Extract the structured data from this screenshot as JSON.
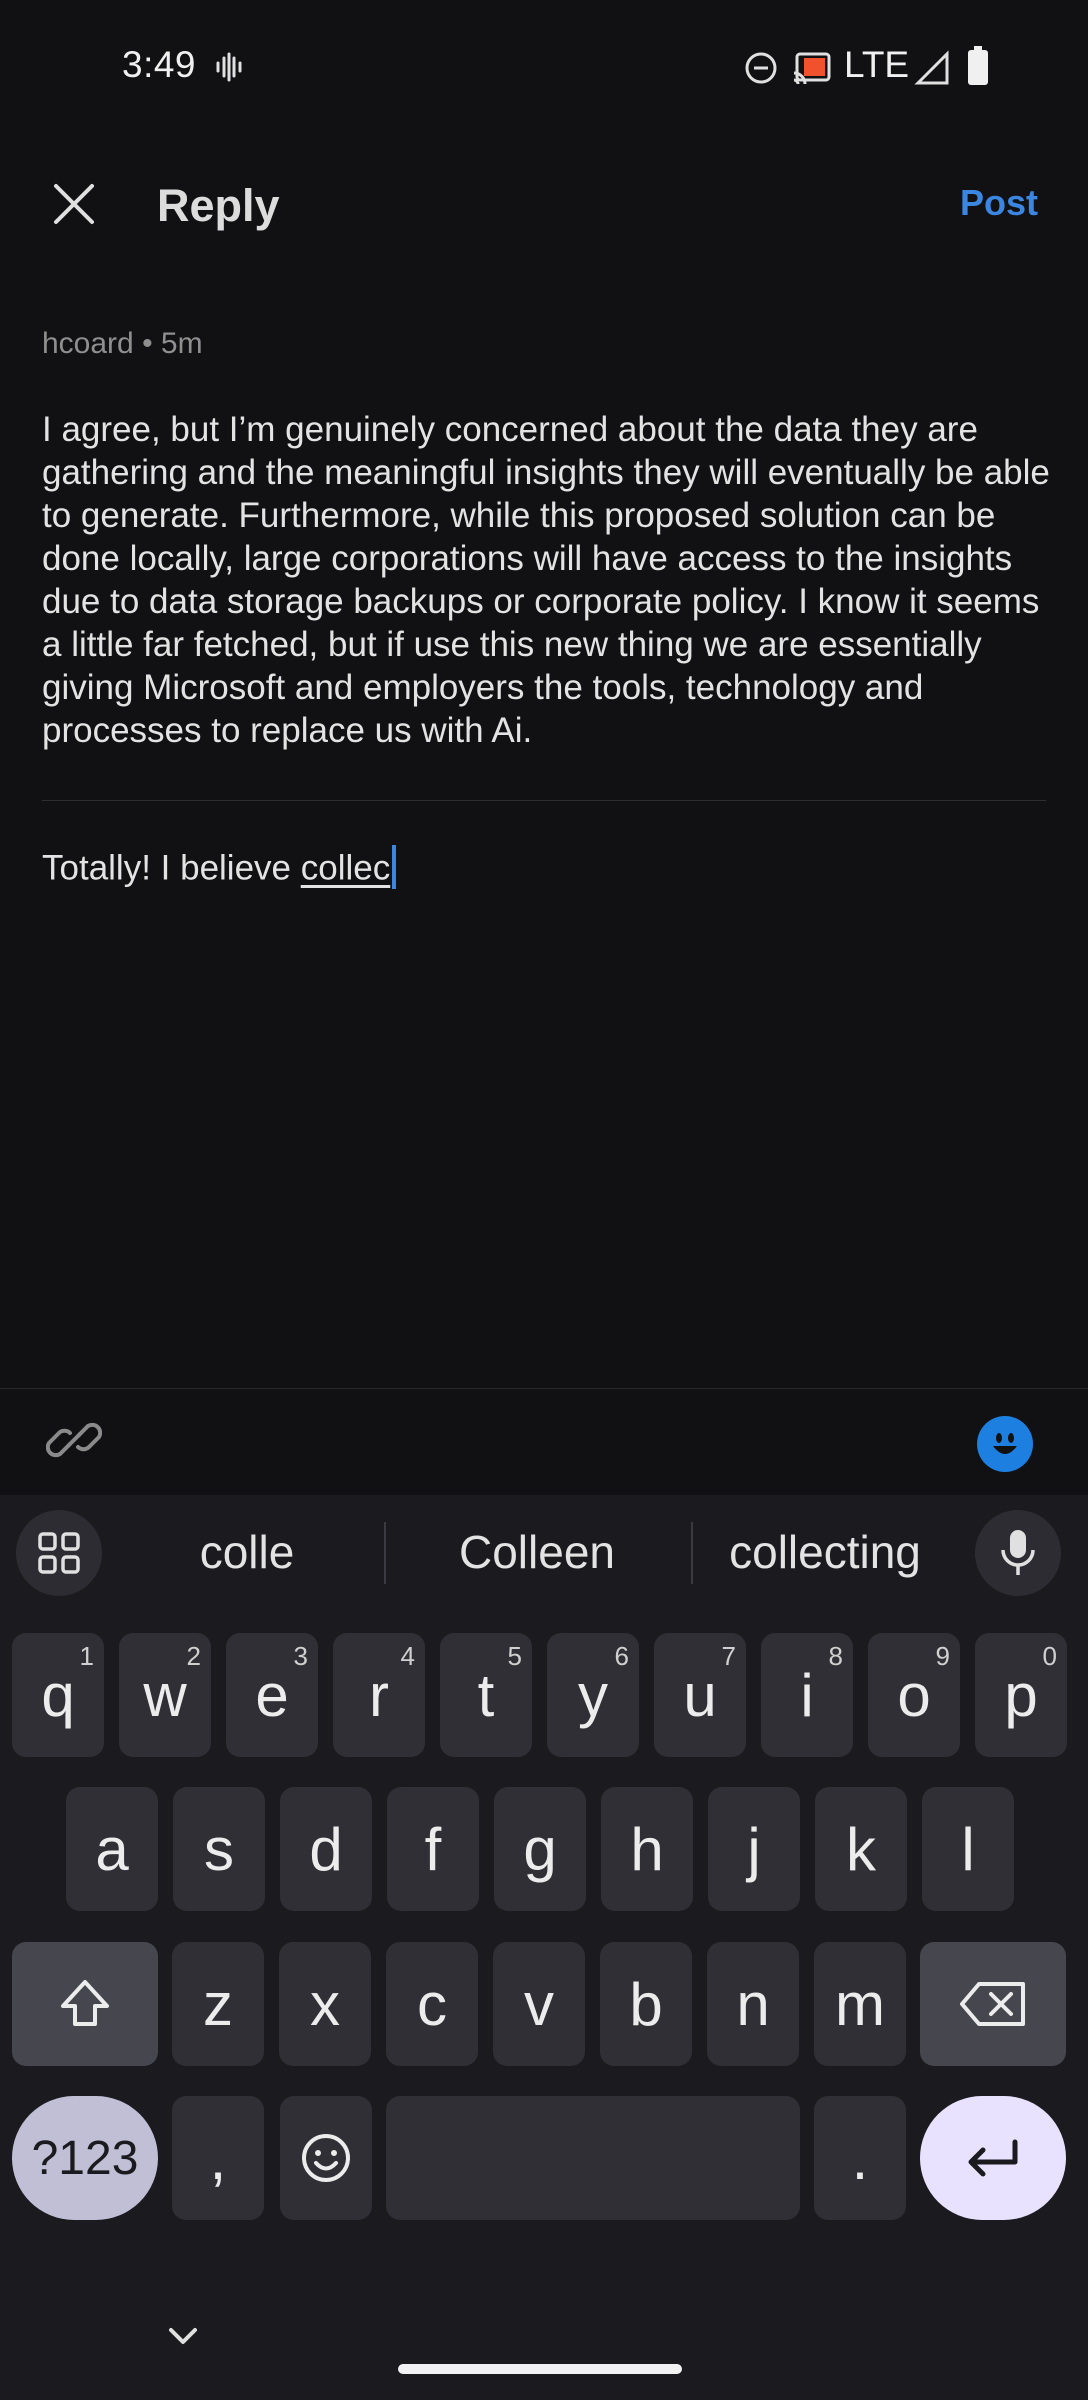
{
  "status_bar": {
    "time": "3:49",
    "network": "LTE",
    "icons": [
      "vibrate-icon",
      "dnd-icon",
      "cast-icon",
      "signal-icon",
      "battery-icon"
    ]
  },
  "header": {
    "title": "Reply",
    "post_label": "Post"
  },
  "comment": {
    "author": "hcoard",
    "age": "5m",
    "meta": "hcoard • 5m",
    "text": "I agree, but I’m genuinely concerned about the data they are gathering and the meaningful insights they will eventually be able to generate. Furthermore, while this proposed solution can be done locally, large corporations will have access to the insights due to data storage backups or corporate policy. I know it seems a little far fetched, but if use this new thing we are essentially giving Microsoft and employers the tools, technology and processes to replace us with Ai."
  },
  "reply": {
    "text_before": "Totally! I believe ",
    "composing": "collec"
  },
  "keyboard": {
    "suggestions": [
      "colle",
      "Colleen",
      "collecting"
    ],
    "row1": [
      {
        "k": "q",
        "n": "1"
      },
      {
        "k": "w",
        "n": "2"
      },
      {
        "k": "e",
        "n": "3"
      },
      {
        "k": "r",
        "n": "4"
      },
      {
        "k": "t",
        "n": "5"
      },
      {
        "k": "y",
        "n": "6"
      },
      {
        "k": "u",
        "n": "7"
      },
      {
        "k": "i",
        "n": "8"
      },
      {
        "k": "o",
        "n": "9"
      },
      {
        "k": "p",
        "n": "0"
      }
    ],
    "row2": [
      "a",
      "s",
      "d",
      "f",
      "g",
      "h",
      "j",
      "k",
      "l"
    ],
    "row3": [
      "z",
      "x",
      "c",
      "v",
      "b",
      "n",
      "m"
    ],
    "symbols_label": "?123",
    "comma": ",",
    "period": "."
  },
  "colors": {
    "background": "#111113",
    "accent": "#3a86e0",
    "keyboard": "#1b1b1f",
    "key": "#2f2f35"
  }
}
